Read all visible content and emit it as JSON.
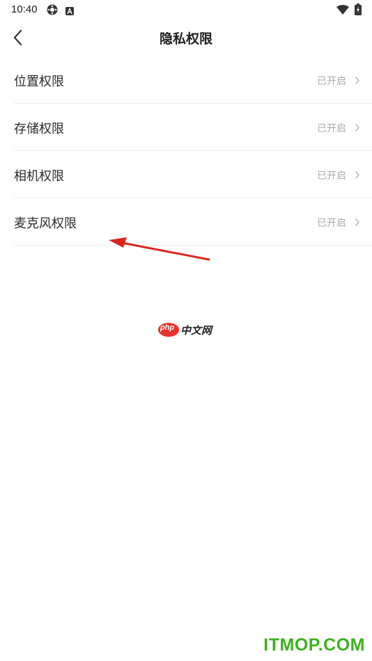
{
  "status_bar": {
    "time": "10:40",
    "icons": [
      "gear-icon",
      "a-notification-icon",
      "wifi-icon",
      "battery-icon"
    ]
  },
  "header": {
    "title": "隐私权限",
    "back_icon": "chevron-left-icon"
  },
  "permissions": [
    {
      "label": "位置权限",
      "status": "已开启"
    },
    {
      "label": "存储权限",
      "status": "已开启"
    },
    {
      "label": "相机权限",
      "status": "已开启"
    },
    {
      "label": "麦克风权限",
      "status": "已开启"
    }
  ],
  "logo": {
    "badge": "php",
    "text": "中文网"
  },
  "watermark": "ITMOP.COM",
  "colors": {
    "annotation_arrow": "#d9261c",
    "watermark": "#3bb11e",
    "status_text": "#a9a9a9",
    "php_badge": "#e5332a"
  }
}
